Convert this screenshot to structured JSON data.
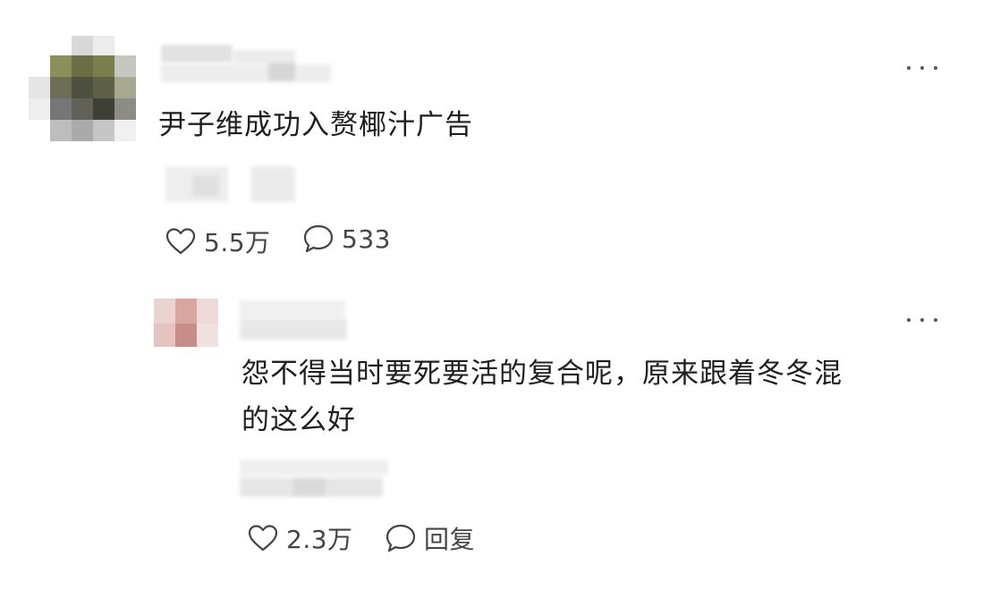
{
  "comments": [
    {
      "text": "尹子维成功入赘椰汁广告",
      "likes": "5.5万",
      "replies": "533",
      "avatar_color": "#6b6e44",
      "more_icon": "ellipsis-icon",
      "like_icon": "heart-outline-icon",
      "reply_icon": "speech-bubble-icon"
    }
  ],
  "reply": {
    "text_line1": "怨不得当时要死要活的复合呢，原来跟着冬冬混",
    "text_line2": "的这么好",
    "likes": "2.3万",
    "reply_label": "回复",
    "avatar_color": "#c98d88",
    "more_icon": "ellipsis-icon",
    "like_icon": "heart-outline-icon",
    "reply_icon": "speech-bubble-icon"
  },
  "colors": {
    "background": "#ffffff",
    "text": "#1f1f1f",
    "meta_text": "#444444",
    "blur_placeholder": "#e6e6e6"
  }
}
